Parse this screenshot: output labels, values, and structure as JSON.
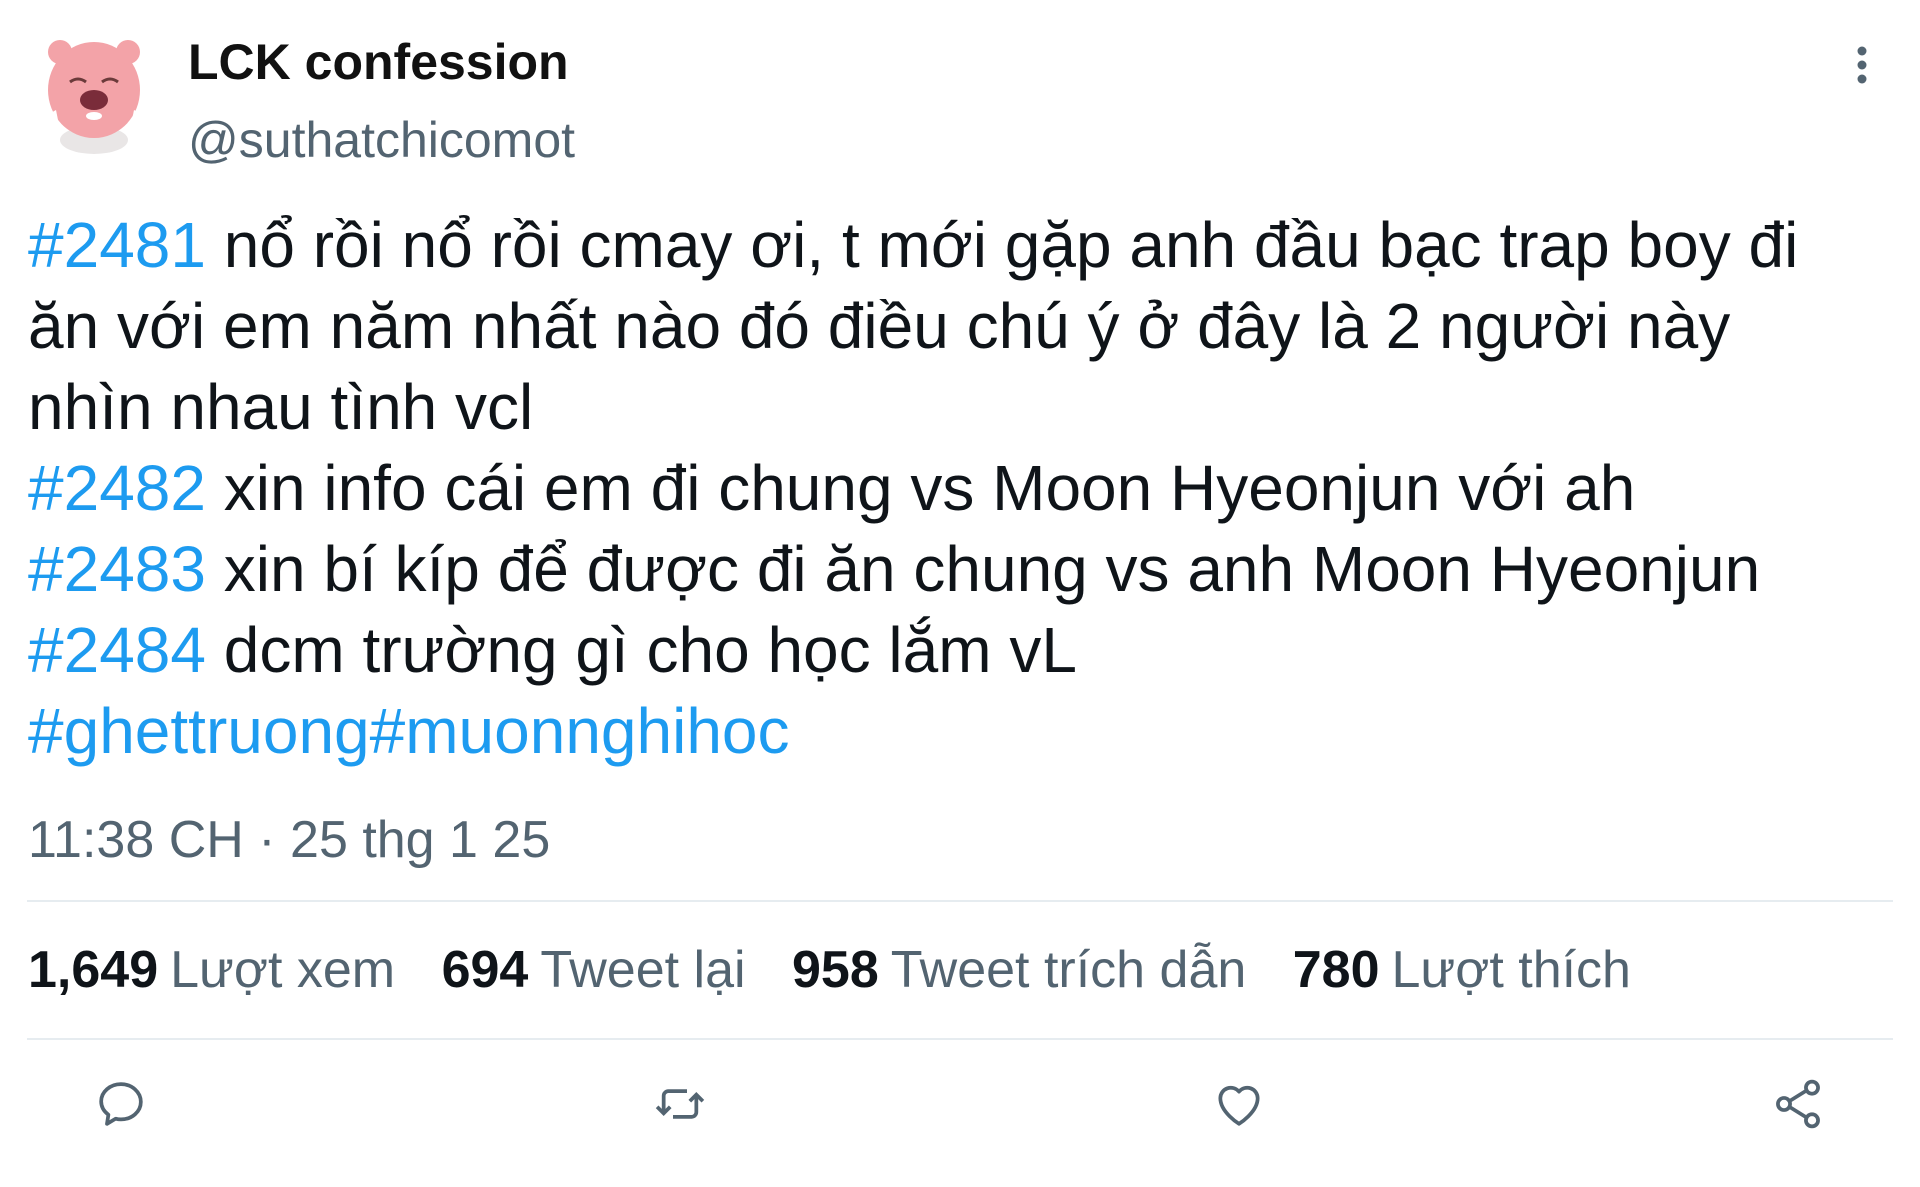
{
  "author": {
    "display_name": "LCK confession",
    "handle": "@suthatchicomot"
  },
  "tweet": {
    "lines": [
      {
        "tag": "#2481",
        "text": " nổ rồi nổ rồi cmay ơi, t mới gặp anh đầu bạc trap boy đi"
      },
      {
        "tag": "",
        "text": "ăn với em năm nhất nào đó điều chú ý ở đây là 2 người này"
      },
      {
        "tag": "",
        "text": "nhìn nhau tình vcl"
      },
      {
        "tag": "#2482",
        "text": " xin info cái em đi chung vs Moon Hyeonjun với ah"
      },
      {
        "tag": "#2483",
        "text": " xin bí kíp để được đi ăn chung vs anh Moon Hyeonjun"
      },
      {
        "tag": "#2484",
        "text": " dcm trường gì cho học lắm vL"
      },
      {
        "tag": "#ghettruong#muonnghihoc",
        "text": ""
      }
    ],
    "timestamp": "11:38 CH · 25 thg 1 25"
  },
  "stats": [
    {
      "count": "1,649",
      "label": "Lượt xem"
    },
    {
      "count": "694",
      "label": "Tweet lại"
    },
    {
      "count": "958",
      "label": "Tweet trích dẫn"
    },
    {
      "count": "780",
      "label": "Lượt thích"
    }
  ],
  "actions": [
    "reply-icon",
    "retweet-icon",
    "like-icon",
    "share-icon"
  ],
  "colors": {
    "hashtag": "#1d9bf0",
    "secondary_text": "#536471",
    "avatar_pink": "#f3a3a8"
  }
}
